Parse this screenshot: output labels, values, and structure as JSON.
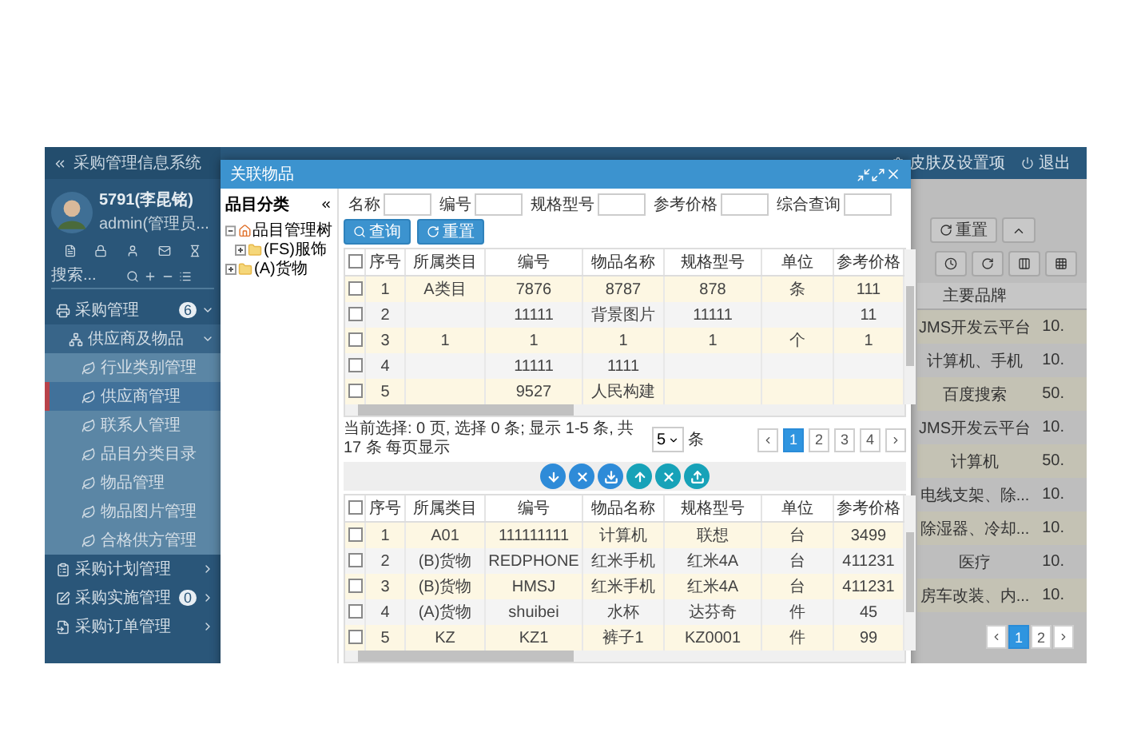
{
  "app": {
    "title": "采购管理信息系统",
    "header_links": [
      "皮肤及设置项",
      "退出"
    ]
  },
  "user": {
    "name": "5791(李昆铭)",
    "role": "admin(管理员..."
  },
  "sidebar": {
    "search": {
      "placeholder": "搜索..."
    },
    "menu": [
      {
        "label": "采购管理",
        "badge": "6",
        "expanded": true,
        "selected": false,
        "children": [
          {
            "label": "供应商及物品",
            "expanded": true,
            "selected": false,
            "children": [
              {
                "label": "行业类别管理",
                "selected": false
              },
              {
                "label": "供应商管理",
                "selected": true
              },
              {
                "label": "联系人管理",
                "selected": false
              },
              {
                "label": "品目分类目录",
                "selected": false
              },
              {
                "label": "物品管理",
                "selected": false
              },
              {
                "label": "物品图片管理",
                "selected": false
              },
              {
                "label": "合格供方管理",
                "selected": false
              }
            ]
          }
        ]
      },
      {
        "label": "采购计划管理",
        "expanded": false,
        "selected": false
      },
      {
        "label": "采购实施管理",
        "badge": "0",
        "expanded": false,
        "selected": false
      },
      {
        "label": "采购订单管理",
        "expanded": false,
        "selected": false
      }
    ]
  },
  "background": {
    "toolbar": [
      "重置"
    ],
    "table": {
      "header": "主要品牌",
      "rows": [
        {
          "brand": "JMS开发云平台",
          "column_2": "10."
        },
        {
          "brand": "计算机、手机",
          "column_2": "10."
        },
        {
          "brand": "百度搜索",
          "column_2": "50."
        },
        {
          "brand": "JMS开发云平台",
          "column_2": "10."
        },
        {
          "brand": "计算机",
          "column_2": "50."
        },
        {
          "brand": "电线支架、除...",
          "column_2": "10."
        },
        {
          "brand": "除湿器、冷却...",
          "column_2": "10."
        },
        {
          "brand": "医疗",
          "column_2": "10."
        },
        {
          "brand": "房车改装、内...",
          "column_2": "10."
        }
      ]
    },
    "pages": [
      {
        "label": "1",
        "selected": true
      },
      {
        "label": "2",
        "selected": false
      }
    ]
  },
  "modal": {
    "title": "关联物品",
    "tree": {
      "title": "品目分类",
      "items": [
        {
          "label": "品目管理树",
          "kind": "home",
          "expanded": true,
          "children": [
            {
              "label": "(FS)服饰",
              "kind": "folder",
              "expanded": false
            }
          ]
        },
        {
          "label": "(A)货物",
          "kind": "folder",
          "expanded": false
        }
      ]
    },
    "filters": [
      "名称",
      "编号",
      "规格型号",
      "参考价格",
      "综合查询"
    ],
    "buttons": [
      "查询",
      "重置"
    ],
    "available": {
      "all_checked": false,
      "columns": [
        "序号",
        "所属类目",
        "编号",
        "物品名称",
        "规格型号",
        "单位",
        "参考价格"
      ],
      "rows": [
        {
          "checked": false,
          "cells": [
            "1",
            "A类目",
            "7876",
            "8787",
            "878",
            "条",
            "111"
          ]
        },
        {
          "checked": false,
          "cells": [
            "2",
            null,
            "11111",
            "背景图片",
            "11111",
            null,
            "11"
          ]
        },
        {
          "checked": false,
          "cells": [
            "3",
            "1",
            "1",
            "1",
            "1",
            "个",
            "1"
          ]
        },
        {
          "checked": false,
          "cells": [
            "4",
            null,
            "11111",
            "1111",
            null,
            null,
            null
          ]
        },
        {
          "checked": false,
          "cells": [
            "5",
            null,
            "9527",
            "人民构建",
            null,
            null,
            null
          ]
        }
      ]
    },
    "pagination": {
      "summary": "当前选择: 0 页, 选择 0 条; 显示 1-5 条, 共 17 条 每页显示",
      "page_size": "5",
      "unit": "条",
      "pages": [
        {
          "label": "1",
          "selected": true
        },
        {
          "label": "2",
          "selected": false
        },
        {
          "label": "3",
          "selected": false
        },
        {
          "label": "4",
          "selected": false
        }
      ]
    },
    "chosen": {
      "all_checked": false,
      "columns": [
        "序号",
        "所属类目",
        "编号",
        "物品名称",
        "规格型号",
        "单位",
        "参考价格"
      ],
      "rows": [
        {
          "checked": false,
          "cells": [
            "1",
            "A01",
            "111111111",
            "计算机",
            "联想",
            "台",
            "3499"
          ]
        },
        {
          "checked": false,
          "cells": [
            "2",
            "(B)货物",
            "REDPHONE",
            "红米手机",
            "红米4A",
            "台",
            "411231"
          ]
        },
        {
          "checked": false,
          "cells": [
            "3",
            "(B)货物",
            "HMSJ",
            "红米手机",
            "红米4A",
            "台",
            "411231"
          ]
        },
        {
          "checked": false,
          "cells": [
            "4",
            "(A)货物",
            "shuibei",
            "水杯",
            "达芬奇",
            "件",
            "45"
          ]
        },
        {
          "checked": false,
          "cells": [
            "5",
            "KZ",
            "KZ1",
            "裤子1",
            "KZ0001",
            "件",
            "99"
          ]
        }
      ]
    }
  }
}
